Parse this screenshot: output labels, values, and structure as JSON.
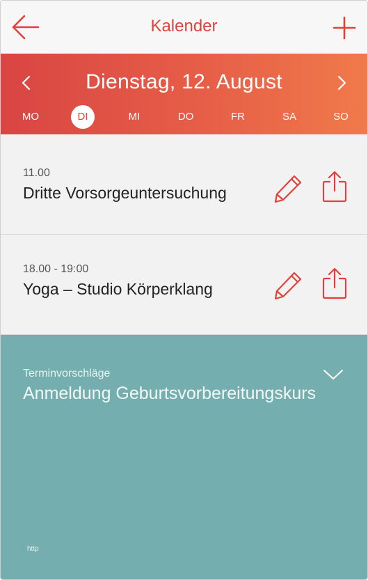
{
  "header": {
    "title": "Kalender",
    "back_icon": "arrow-left-icon",
    "add_icon": "plus-icon",
    "accent": "#e0413a"
  },
  "date_bar": {
    "date": "Dienstag, 12. August",
    "prev_icon": "chevron-left-icon",
    "next_icon": "chevron-right-icon",
    "gradient": [
      "#d94543",
      "#f07a4a"
    ],
    "days": [
      "MO",
      "DI",
      "MI",
      "DO",
      "FR",
      "SA",
      "SO"
    ],
    "selected_day": "DI"
  },
  "events": [
    {
      "time": "11.00",
      "title": "Dritte Vorsorgeuntersuchung",
      "edit_icon": "pencil-icon",
      "share_icon": "share-icon"
    },
    {
      "time": "18.00 - 19:00",
      "title": "Yoga – Studio Körperklang",
      "edit_icon": "pencil-icon",
      "share_icon": "share-icon"
    }
  ],
  "suggestions": {
    "label": "Terminvorschläge",
    "course": "Anmeldung Geburtsvorbereitungskurs",
    "toggle_icon": "chevron-down-icon",
    "background": "#75aeae",
    "footer": "http"
  }
}
